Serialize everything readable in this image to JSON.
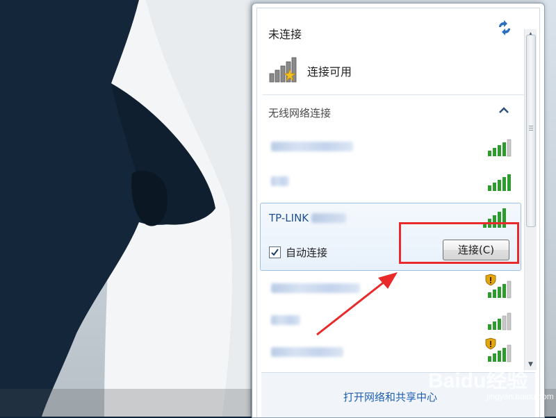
{
  "flyout": {
    "status_title": "未连接",
    "availability_text": "连接可用",
    "section_title": "无线网络连接",
    "footer_link": "打开网络和共享中心"
  },
  "networks": [
    {
      "name_visible": false,
      "signal_level": 4,
      "secured": false
    },
    {
      "name_visible": false,
      "signal_level": 4,
      "secured": false
    },
    {
      "name": "TP-LINK",
      "signal_level": 5,
      "selected": true,
      "secured": false
    },
    {
      "name_visible": false,
      "signal_level": 4,
      "secured": true
    },
    {
      "name_visible": false,
      "signal_level": 4,
      "secured": false
    },
    {
      "name_visible": false,
      "signal_level": 4,
      "secured": true
    }
  ],
  "selected_network": {
    "name": "TP-LINK",
    "auto_connect_label": "自动连接",
    "auto_connect_checked": true,
    "connect_button_label": "连接(C)"
  },
  "watermark": {
    "logo_text": "Baidu经验",
    "url_text": "jingyan.baidu.com"
  },
  "colors": {
    "highlight_box": "#e82a2a",
    "annotation_arrow": "#e82a2a",
    "link": "#1f5fb4",
    "selected_text": "#1b4f92",
    "signal_green": "#2e9b2e"
  }
}
